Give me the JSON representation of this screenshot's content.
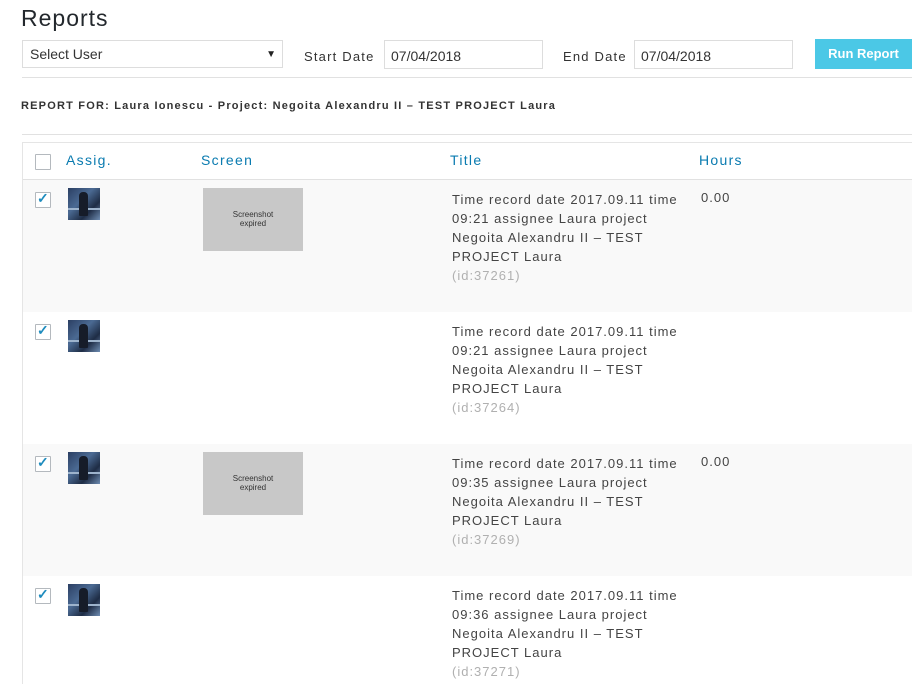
{
  "page": {
    "title": "Reports"
  },
  "filters": {
    "user_select": "Select User",
    "start_label": "Start Date",
    "start_value": "07/04/2018",
    "end_label": "End Date",
    "end_value": "07/04/2018",
    "run_label": "Run Report"
  },
  "report_for": "REPORT FOR: Laura Ionescu - Project: Negoita Alexandru II – TEST PROJECT Laura",
  "table": {
    "headers": {
      "assig": "Assig.",
      "screen": "Screen",
      "title": "Title",
      "hours": "Hours"
    },
    "rows": [
      {
        "checked": true,
        "screenshot": "Screenshot expired",
        "has_screenshot": true,
        "title": "Time record date 2017.09.11 time 09:21 assignee Laura project Negoita Alexandru II – TEST PROJECT Laura",
        "id": "(id:37261)",
        "hours": "0.00"
      },
      {
        "checked": true,
        "screenshot": "",
        "has_screenshot": false,
        "title": "Time record date 2017.09.11 time 09:21 assignee Laura project Negoita Alexandru II – TEST PROJECT Laura",
        "id": "(id:37264)",
        "hours": ""
      },
      {
        "checked": true,
        "screenshot": "Screenshot expired",
        "has_screenshot": true,
        "title": "Time record date 2017.09.11 time 09:35 assignee Laura project Negoita Alexandru II – TEST PROJECT Laura",
        "id": "(id:37269)",
        "hours": "0.00"
      },
      {
        "checked": true,
        "screenshot": "",
        "has_screenshot": false,
        "title": "Time record date 2017.09.11 time 09:36 assignee Laura project Negoita Alexandru II – TEST PROJECT Laura",
        "id": "(id:37271)",
        "hours": ""
      }
    ]
  },
  "icons": {
    "checkbox_check": "check-icon",
    "dropdown": "chevron-down-icon",
    "avatar": "user-avatar-icon"
  },
  "colors": {
    "accent": "#4bc8e6",
    "header_link": "#0a7bb0",
    "checkbox": "#1e8cbe"
  }
}
